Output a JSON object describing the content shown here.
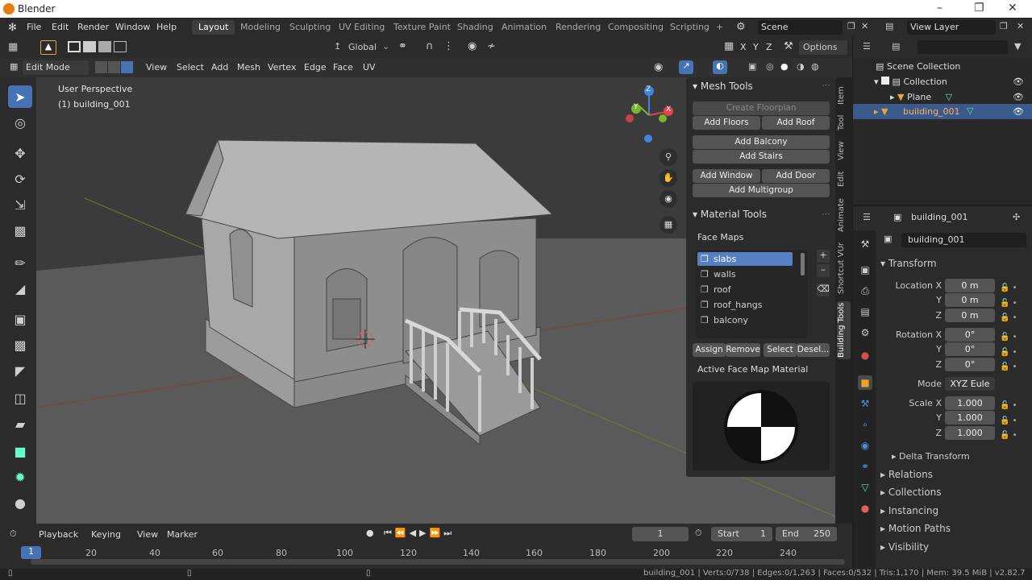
{
  "app": {
    "title": "Blender"
  },
  "menu": [
    "File",
    "Edit",
    "Render",
    "Window",
    "Help"
  ],
  "workspaces": [
    "Layout",
    "Modeling",
    "Sculpting",
    "UV Editing",
    "Texture Paint",
    "Shading",
    "Animation",
    "Rendering",
    "Compositing",
    "Scripting"
  ],
  "workspace_add": "+",
  "scene": "Scene",
  "view_layer": "View Layer",
  "header": {
    "transform_orientation": "Global",
    "axes": [
      "X",
      "Y",
      "Z"
    ],
    "options": "Options"
  },
  "header2": {
    "mode": "Edit Mode",
    "items": [
      "View",
      "Select",
      "Add",
      "Mesh",
      "Vertex",
      "Edge",
      "Face",
      "UV"
    ]
  },
  "viewport": {
    "perspective": "User Perspective",
    "object": "(1) building_001",
    "gizmo": {
      "x": "X",
      "y": "Y",
      "z": "Z"
    }
  },
  "npanel": {
    "mesh_tools": {
      "title": "Mesh Tools",
      "create_floorplan": "Create Floorplan",
      "add_floors": "Add Floors",
      "add_roof": "Add Roof",
      "add_balcony": "Add Balcony",
      "add_stairs": "Add Stairs",
      "add_window": "Add Window",
      "add_door": "Add Door",
      "add_multigroup": "Add Multigroup"
    },
    "material_tools": {
      "title": "Material Tools",
      "face_maps_label": "Face Maps",
      "face_maps": [
        "slabs",
        "walls",
        "roof",
        "roof_hangs",
        "balcony"
      ],
      "assign": "Assign",
      "remove": "Remove",
      "select": "Select",
      "deselect": "Desel...",
      "active_material": "Active Face Map Material"
    },
    "tabs": [
      "Item",
      "Tool",
      "View",
      "Edit",
      "Animate",
      "Shortcut VUr",
      "Building Tools"
    ]
  },
  "outliner": {
    "root": "Scene Collection",
    "collection": "Collection",
    "items": [
      "Plane",
      "building_001"
    ]
  },
  "properties": {
    "object_name": "building_001",
    "data_name": "building_001",
    "transform": {
      "title": "Transform",
      "location_label": "Location X",
      "location": [
        "0 m",
        "0 m",
        "0 m"
      ],
      "rotation_label": "Rotation X",
      "rotation": [
        "0°",
        "0°",
        "0°"
      ],
      "mode_label": "Mode",
      "mode": "XYZ Eule",
      "scale_label": "Scale X",
      "scale": [
        "1.000",
        "1.000",
        "1.000"
      ],
      "axis_y": "Y",
      "axis_z": "Z",
      "delta": "Delta Transform"
    },
    "collapsed": [
      "Relations",
      "Collections",
      "Instancing",
      "Motion Paths",
      "Visibility"
    ]
  },
  "timeline": {
    "menus": [
      "Playback",
      "Keying",
      "View",
      "Marker"
    ],
    "current_frame": "1",
    "start_label": "Start",
    "start": "1",
    "end_label": "End",
    "end": "250",
    "ticks": [
      "1",
      "20",
      "40",
      "60",
      "80",
      "100",
      "120",
      "140",
      "160",
      "180",
      "200",
      "220",
      "240"
    ]
  },
  "status": {
    "text": "building_001 | Verts:0/738 | Edges:0/1,263 | Faces:0/532 | Tris:1,170 | Mem: 39.5 MiB | v2.82.7"
  },
  "colors": {
    "accent": "#4772b3",
    "orange": "#e87d0d",
    "x_axis": "#e0434b",
    "y_axis": "#79b82b",
    "z_axis": "#3e86dd"
  }
}
